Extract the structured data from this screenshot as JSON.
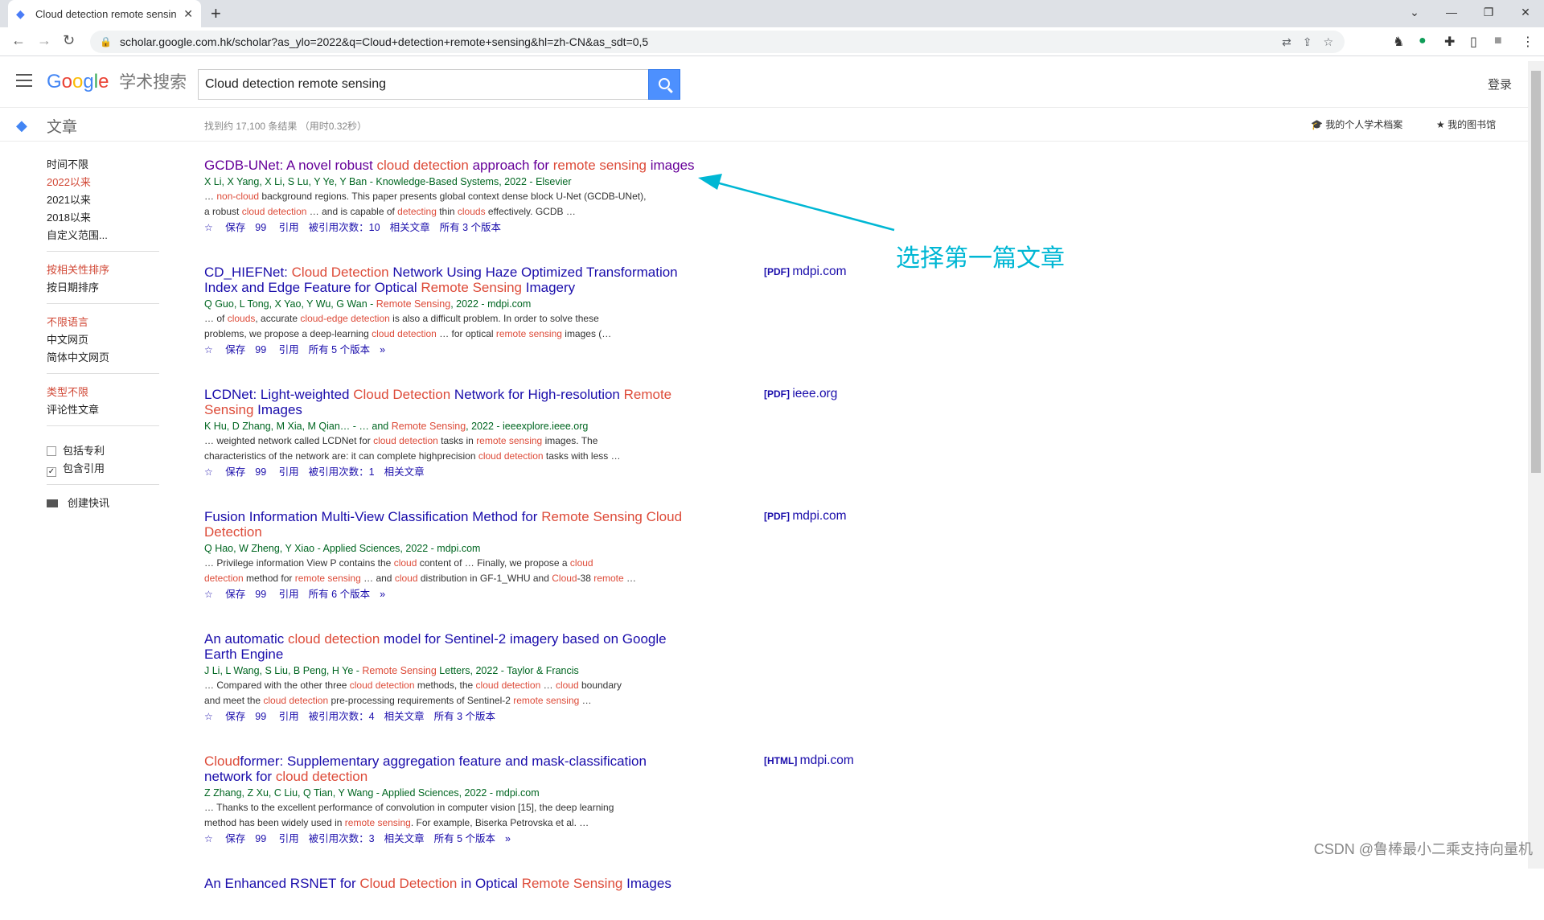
{
  "browser": {
    "tab_title": "Cloud detection remote sensin",
    "url": "scholar.google.com.hk/scholar?as_ylo=2022&q=Cloud+detection+remote+sensing&hl=zh-CN&as_sdt=0,5"
  },
  "header": {
    "logo_sub": "学术搜索",
    "query": "Cloud detection remote sensing",
    "login": "登录",
    "section": "文章",
    "result_count": "找到约 17,100 条结果 （用时0.32秒）",
    "profile": "我的个人学术档案",
    "library": "我的图书馆"
  },
  "sidebar": {
    "time": [
      "时间不限",
      "2022以来",
      "2021以来",
      "2018以来",
      "自定义范围..."
    ],
    "sort": [
      "按相关性排序",
      "按日期排序"
    ],
    "lang": [
      "不限语言",
      "中文网页",
      "简体中文网页"
    ],
    "type": [
      "类型不限",
      "评论性文章"
    ],
    "patents": "包括专利",
    "citations": "包含引用",
    "alert": "创建快讯"
  },
  "results": [
    {
      "title": "GCDB-UNet: A novel robust cloud detection approach for remote sensing images",
      "authors": "X Li, X Yang, X Li, S Lu, Y Ye, Y Ban - Knowledge-Based Systems, 2022 - Elsevier",
      "snippet1": "… non-cloud background regions. This paper presents global context dense block U-Net (GCDB-UNet),",
      "snippet2": "a robust cloud detection … and is capable of detecting thin clouds effectively. GCDB …",
      "actions": [
        "保存",
        "引用",
        "被引用次数：10",
        "相关文章",
        "所有 3 个版本"
      ],
      "pdf": ""
    },
    {
      "title": "CD_HIEFNet: Cloud Detection Network Using Haze Optimized Transformation Index and Edge Feature for Optical Remote Sensing Imagery",
      "authors": "Q Guo, L Tong, X Yao, Y Wu, G Wan - Remote Sensing, 2022 - mdpi.com",
      "snippet1": "… of clouds, accurate cloud-edge detection is also a difficult problem. In order to solve these",
      "snippet2": "problems, we propose a deep-learning cloud detection … for optical remote sensing images (…",
      "actions": [
        "保存",
        "引用",
        "所有 5 个版本",
        "»"
      ],
      "pdf": "mdpi.com",
      "pdf_tag": "[PDF]"
    },
    {
      "title": "LCDNet: Light-weighted Cloud Detection Network for High-resolution Remote Sensing Images",
      "authors": "K Hu, D Zhang, M Xia, M Qian… - … and Remote Sensing, 2022 - ieeexplore.ieee.org",
      "snippet1": "… weighted network called LCDNet for cloud detection tasks in remote sensing images. The",
      "snippet2": "characteristics of the network are: it can complete highprecision cloud detection tasks with less …",
      "actions": [
        "保存",
        "引用",
        "被引用次数：1",
        "相关文章"
      ],
      "pdf": "ieee.org",
      "pdf_tag": "[PDF]"
    },
    {
      "title": "Fusion Information Multi-View Classification Method for Remote Sensing Cloud Detection",
      "authors": "Q Hao, W Zheng, Y Xiao - Applied Sciences, 2022 - mdpi.com",
      "snippet1": "… Privilege information View P contains the cloud content of … Finally, we propose a cloud",
      "snippet2": "detection method for remote sensing … and cloud distribution in GF-1_WHU and Cloud-38 remote …",
      "actions": [
        "保存",
        "引用",
        "所有 6 个版本",
        "»"
      ],
      "pdf": "mdpi.com",
      "pdf_tag": "[PDF]"
    },
    {
      "title": "An automatic cloud detection model for Sentinel-2 imagery based on Google Earth Engine",
      "authors": "J Li, L Wang, S Liu, B Peng, H Ye - Remote Sensing Letters, 2022 - Taylor & Francis",
      "snippet1": "… Compared with the other three cloud detection methods, the cloud detection … cloud boundary",
      "snippet2": "and meet the cloud detection pre-processing requirements of Sentinel-2 remote sensing …",
      "actions": [
        "保存",
        "引用",
        "被引用次数：4",
        "相关文章",
        "所有 3 个版本"
      ],
      "pdf": ""
    },
    {
      "title": "Cloudformer: Supplementary aggregation feature and mask-classification network for cloud detection",
      "authors": "Z Zhang, Z Xu, C Liu, Q Tian, Y Wang - Applied Sciences, 2022 - mdpi.com",
      "snippet1": "… Thanks to the excellent performance of convolution in computer vision [15], the deep learning",
      "snippet2": "method has been widely used in remote sensing. For example, Biserka Petrovska et al. …",
      "actions": [
        "保存",
        "引用",
        "被引用次数：3",
        "相关文章",
        "所有 5 个版本",
        "»"
      ],
      "pdf": "mdpi.com",
      "pdf_tag": "[HTML]"
    },
    {
      "title": "An Enhanced RSNET for Cloud Detection in Optical Remote Sensing Images",
      "authors": "",
      "snippet1": "",
      "snippet2": "",
      "actions": [],
      "pdf": ""
    }
  ],
  "annotation": "选择第一篇文章",
  "watermark": "CSDN @鲁棒最小二乘支持向量机",
  "colors": {
    "link": "#1a0dab",
    "highlight": "#dd4b39",
    "green": "#006621",
    "accent": "#00b7d4"
  }
}
